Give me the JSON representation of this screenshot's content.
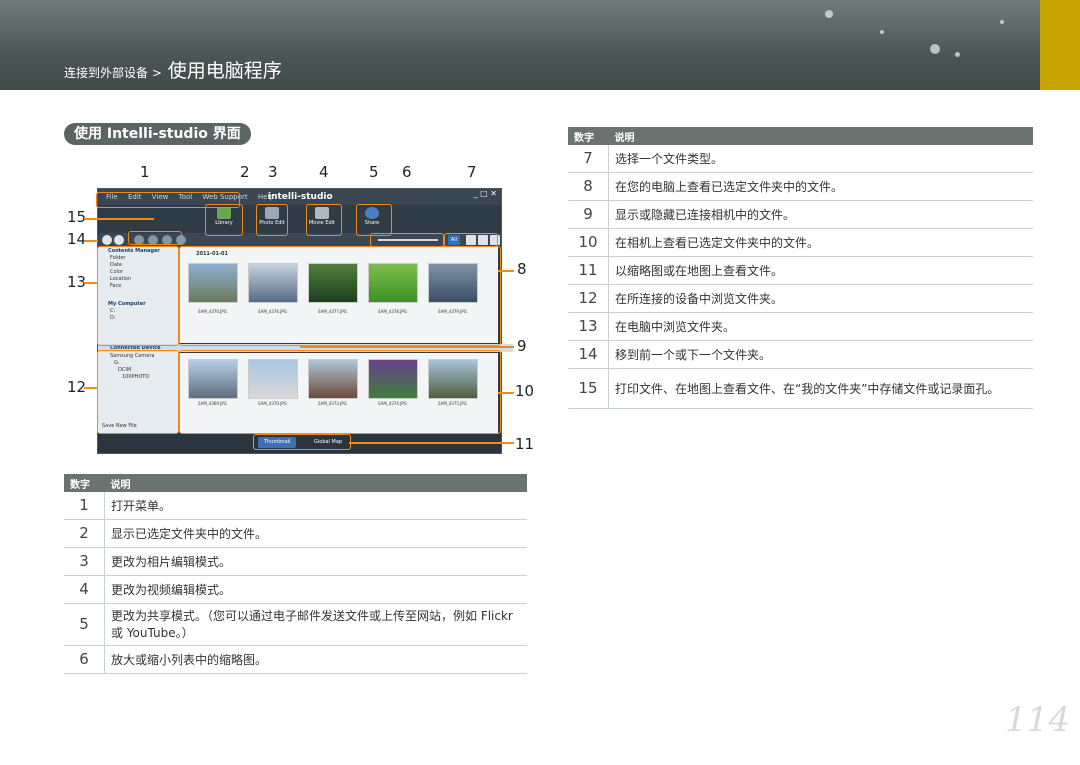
{
  "header": {
    "breadcrumb_small": "连接到外部设备 >",
    "breadcrumb_big": "使用电脑程序"
  },
  "section_title": "使用 Intelli-studio 界面",
  "screenshot": {
    "menu": [
      "File",
      "Edit",
      "View",
      "Tool",
      "Web Support",
      "Help"
    ],
    "logo": "intelli-studio",
    "modes": [
      "Library",
      "Photo Edit",
      "Movie Edit",
      "Share"
    ],
    "tree_header": "Contents Manager",
    "tree_items": [
      "Folder",
      "Date",
      "Color",
      "Location",
      "Face"
    ],
    "my_computer": "My Computer",
    "drives": [
      "C:",
      "D:"
    ],
    "connected_device": "Connected Device",
    "device_items": [
      "Samsung Camera",
      "G:",
      "DCIM",
      "100PHOTO"
    ],
    "date_label": "2011-01-01",
    "files_top": [
      "SAM_4370.JPG",
      "SAM_4376.JPG",
      "SAM_4377.JPG",
      "SAM_4378.JPG",
      "SAM_4379.JPG"
    ],
    "files_bottom": [
      "SAM_4369.JPG",
      "SAM_4370.JPG",
      "SAM_4373.JPG",
      "SAM_4374.JPG",
      "SAM_4375.JPG"
    ],
    "save_new_file": "Save New File",
    "tab_thumbnail": "Thumbnail",
    "tab_map": "Global Map",
    "view_all": "All",
    "callouts": [
      "1",
      "2",
      "3",
      "4",
      "5",
      "6",
      "7",
      "8",
      "9",
      "10",
      "11",
      "12",
      "13",
      "14",
      "15"
    ]
  },
  "table_left": {
    "head_num": "数字",
    "head_desc": "说明",
    "rows": [
      {
        "n": "1",
        "text": "打开菜单。"
      },
      {
        "n": "2",
        "text": "显示已选定文件夹中的文件。"
      },
      {
        "n": "3",
        "text": "更改为相片编辑模式。"
      },
      {
        "n": "4",
        "text": "更改为视频编辑模式。"
      },
      {
        "n": "5",
        "text": "更改为共享模式。（您可以通过电子邮件发送文件或上传至网站，例如 Flickr 或 YouTube。）"
      },
      {
        "n": "6",
        "text": "放大或缩小列表中的缩略图。"
      }
    ]
  },
  "table_right": {
    "head_num": "数字",
    "head_desc": "说明",
    "rows": [
      {
        "n": "7",
        "text": "选择一个文件类型。"
      },
      {
        "n": "8",
        "text": "在您的电脑上查看已选定文件夹中的文件。"
      },
      {
        "n": "9",
        "text": "显示或隐藏已连接相机中的文件。"
      },
      {
        "n": "10",
        "text": "在相机上查看已选定文件夹中的文件。"
      },
      {
        "n": "11",
        "text": "以缩略图或在地图上查看文件。"
      },
      {
        "n": "12",
        "text": "在所连接的设备中浏览文件夹。"
      },
      {
        "n": "13",
        "text": "在电脑中浏览文件夹。"
      },
      {
        "n": "14",
        "text": "移到前一个或下一个文件夹。"
      },
      {
        "n": "15",
        "text": "打印文件、在地图上查看文件、在“我的文件夹”中存储文件或记录面孔。"
      }
    ]
  },
  "page_number": "114"
}
